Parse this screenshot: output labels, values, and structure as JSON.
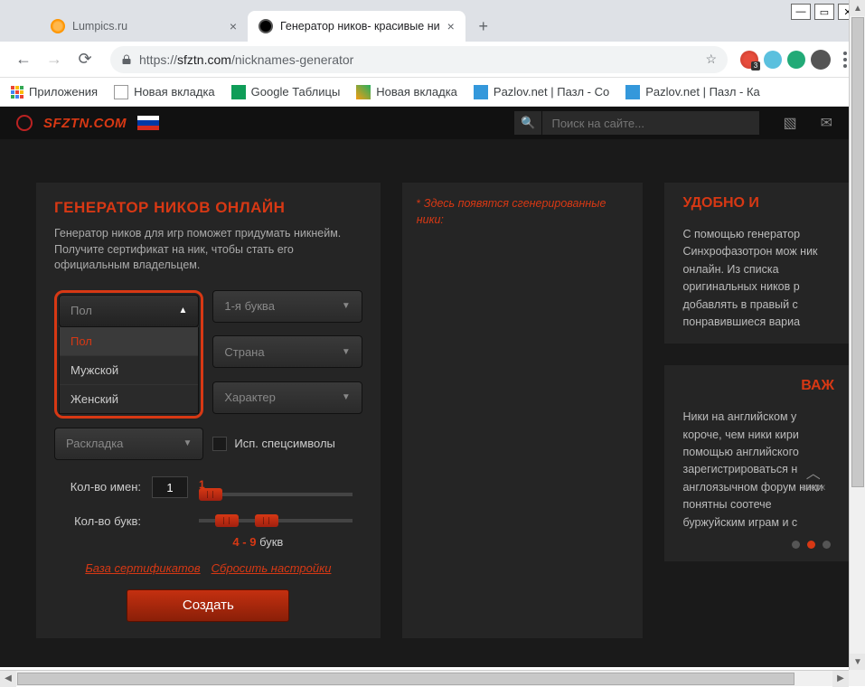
{
  "window": {
    "min": "—",
    "max": "▭",
    "close": "✕"
  },
  "tabs": [
    {
      "title": "Lumpics.ru",
      "active": false
    },
    {
      "title": "Генератор ников- красивые ни",
      "active": true
    }
  ],
  "addr": {
    "proto": "https://",
    "host": "sfztn.com",
    "path": "/nicknames-generator"
  },
  "bookmarks": [
    {
      "label": "Приложения"
    },
    {
      "label": "Новая вкладка"
    },
    {
      "label": "Google Таблицы"
    },
    {
      "label": "Новая вкладка"
    },
    {
      "label": "Pazlov.net | Пазл - Со"
    },
    {
      "label": "Pazlov.net | Пазл - Ка"
    }
  ],
  "site": {
    "logo": "SFZTN.COM",
    "search_placeholder": "Поиск на сайте..."
  },
  "gen": {
    "title": "ГЕНЕРАТОР НИКОВ ОНЛАЙН",
    "desc": "Генератор ников для игр поможет придумать никнейм. Получите сертификат на ник, чтобы стать его официальным владельцем.",
    "selects": {
      "gender": {
        "label": "Пол",
        "options": [
          "Пол",
          "Мужской",
          "Женский"
        ]
      },
      "first_letter": "1-я буква",
      "country": "Страна",
      "character": "Характер",
      "layout": "Раскладка"
    },
    "special_chars": "Исп. спецсимволы",
    "count_names_label": "Кол-во имен:",
    "count_names_value": "1",
    "count_names_indicator": "1",
    "count_letters_label": "Кол-во букв:",
    "range": {
      "min": "4",
      "sep": " - ",
      "max": "9",
      "suffix": "  букв"
    },
    "link_cert": "База сертификатов",
    "link_reset": "Сбросить настройки",
    "create": "Создать"
  },
  "output": {
    "asterisk": "*",
    "text": " Здесь появятся сгенерированные ники:"
  },
  "side1": {
    "title": "УДОБНО И",
    "text": "С помощью генератор Синхрофазотрон мож ник онлайн. Из списка оригинальных ников р добавлять в правый с понравившиеся вариа"
  },
  "side2": {
    "title": "ВАЖ",
    "text": "Ники на английском у короче, чем ники кири помощью английского зарегистрироваться н англоязычном форум ники понятны соотече буржуйским играм и с"
  },
  "scroll_top": "вверх"
}
